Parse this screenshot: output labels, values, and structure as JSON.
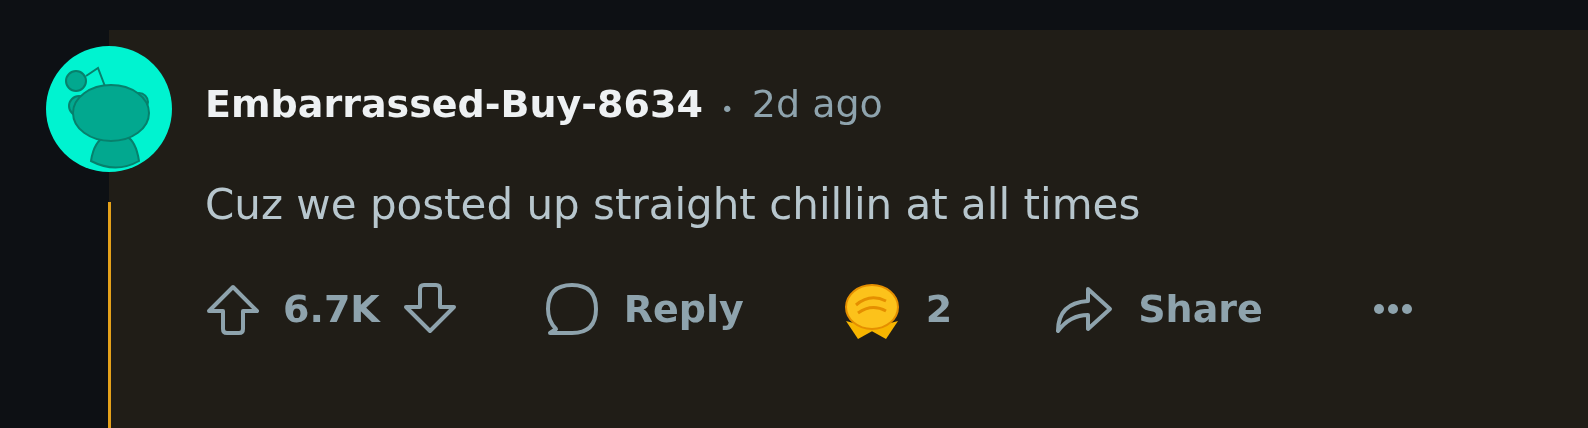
{
  "comment": {
    "author": "Embarrassed-Buy-8634",
    "separator": "•",
    "time": "2d ago",
    "body": "Cuz we posted up straight chillin at all times"
  },
  "actions": {
    "score": "6.7K",
    "reply": "Reply",
    "award_count": "2",
    "share": "Share"
  }
}
